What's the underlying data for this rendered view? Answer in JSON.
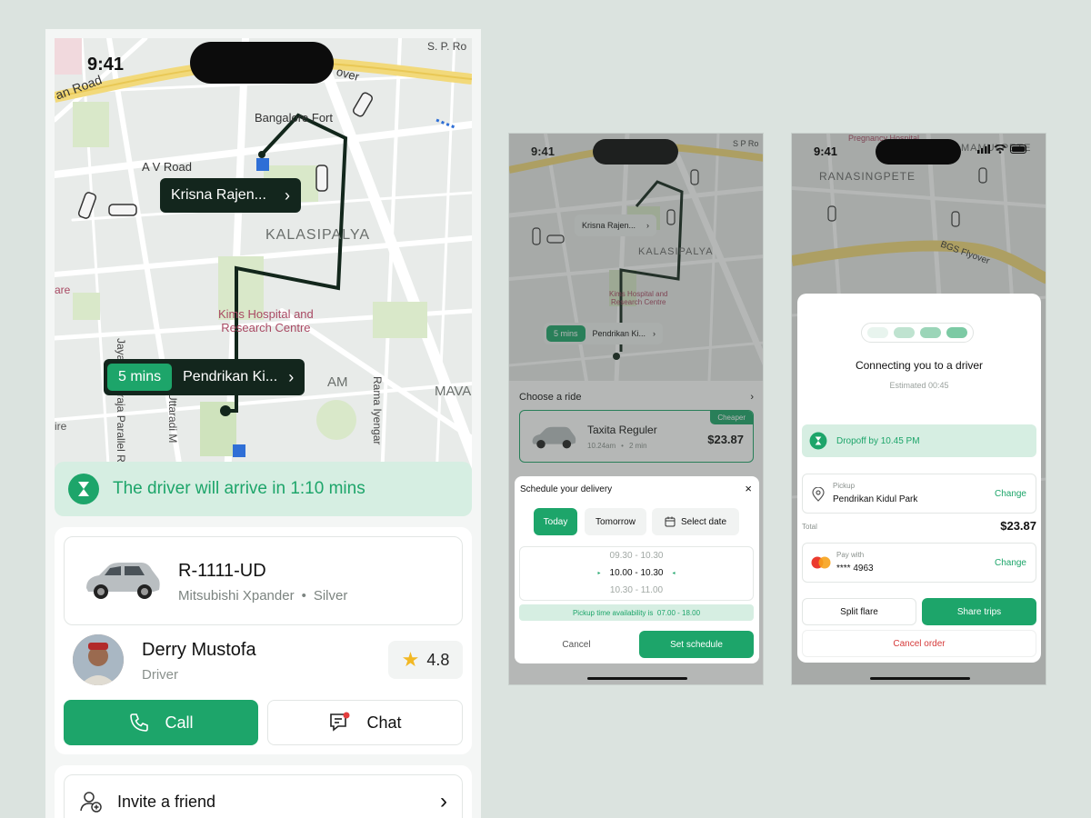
{
  "status": {
    "time": "9:41"
  },
  "p1": {
    "map_labels": {
      "road": "an Road",
      "sp": "S. P. Ro",
      "flyover": "over",
      "fort": "Bangalore Fort",
      "avroad": "A V Road",
      "area": "KALASIPALYA",
      "hospital": "Kims Hospital and\nResearch Centre",
      "are": "are",
      "ire": "ire",
      "am": "AM",
      "mav": "MAVA",
      "parallel": "Jayachamaraja Parallel Rd",
      "uttaradi": "Uttaradi M",
      "rama": "Rama Iyengar"
    },
    "pickup_pill": "Krisna Rajen...",
    "drop_mins": "5 mins",
    "drop_pill": "Pendrikan Ki...",
    "arrival_text": "The driver will arrive in 1:10 mins",
    "car": {
      "plate": "R-1111-UD",
      "model": "Mitsubishi Xpander",
      "color": "Silver"
    },
    "driver": {
      "name": "Derry Mustofa",
      "role": "Driver",
      "rating": "4.8"
    },
    "call_label": "Call",
    "chat_label": "Chat",
    "invite_label": "Invite a friend"
  },
  "p2": {
    "pickup_pill": "Krisna Rajen...",
    "drop_mins": "5 mins",
    "drop_pill": "Pendrikan Ki...",
    "map_labels": {
      "area": "KALASIPALYA",
      "hospital": "Kims Hospital and\nResearch Centre",
      "sp": "S P Ro"
    },
    "choose_ride": "Choose a ride",
    "ride": {
      "name": "Taxita Reguler",
      "time": "10.24am",
      "eta": "2 min",
      "price": "$23.87",
      "badge": "Cheaper"
    },
    "sheet": {
      "title": "Schedule your delivery",
      "tabs": [
        "Today",
        "Tomorrow",
        "Select date"
      ],
      "slots": [
        "09.30 - 10.30",
        "10.00 - 10.30",
        "10.30 - 11.00"
      ],
      "availability": "Pickup time availability is  07.00 - 18.00",
      "cancel": "Cancel",
      "confirm": "Set schedule"
    }
  },
  "p3": {
    "map_labels": {
      "top": "Pregnancy Hospital",
      "area": "RANASINGPETE",
      "right": "MAMULPETE",
      "flyover": "BGS Flyover"
    },
    "connecting": "Connecting you to a driver",
    "estimated": "Estimated 00:45",
    "dropoff": "Dropoff by 10.45 PM",
    "pickup_label": "Pickup",
    "pickup_value": "Pendrikan Kidul Park",
    "change": "Change",
    "total_label": "Total",
    "total_value": "$23.87",
    "pay_label": "Pay with",
    "pay_value": "**** 4963",
    "split": "Split flare",
    "share": "Share trips",
    "cancel_order": "Cancel order"
  },
  "colors": {
    "accent": "#1da56a",
    "dark": "#13261d",
    "tint": "#d6eee2",
    "danger": "#d63a3a"
  }
}
